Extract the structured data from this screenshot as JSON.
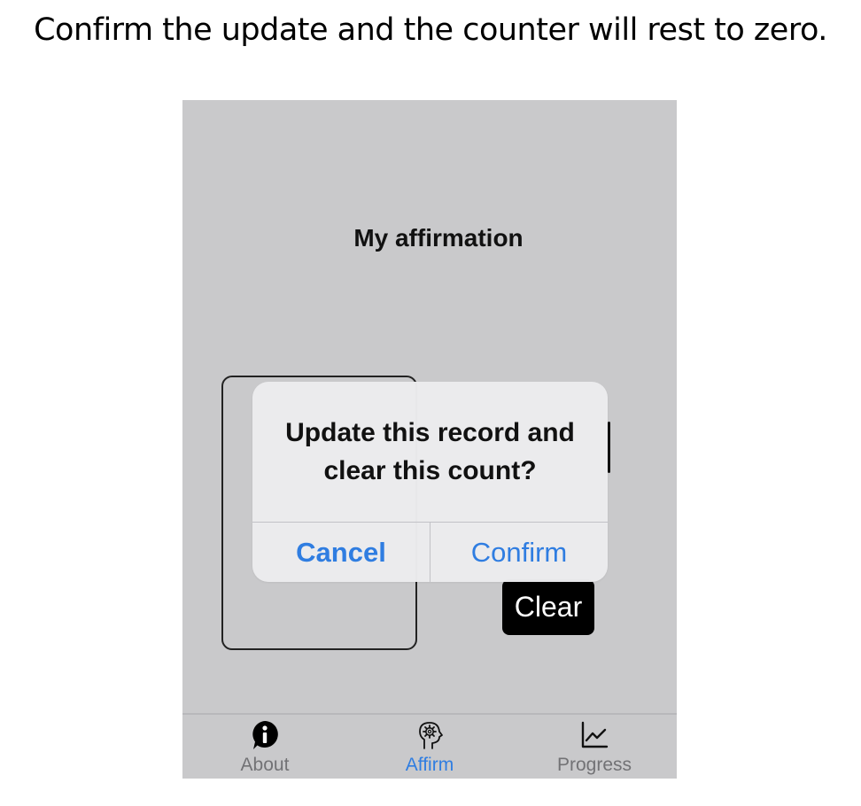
{
  "caption": "Confirm the update and the counter will rest to zero.",
  "screen": {
    "title": "My affirmation",
    "clear_label": "Clear"
  },
  "alert": {
    "message": "Update this record and clear this count?",
    "cancel_label": "Cancel",
    "confirm_label": "Confirm"
  },
  "tabbar": {
    "tabs": [
      {
        "label": "About",
        "icon": "info-bubble-icon",
        "active": false
      },
      {
        "label": "Affirm",
        "icon": "head-gear-icon",
        "active": true
      },
      {
        "label": "Progress",
        "icon": "line-chart-icon",
        "active": false
      }
    ]
  },
  "colors": {
    "screen_bg": "#c9c9cb",
    "accent": "#2f7de1",
    "inactive_tab": "#727275",
    "alert_bg": "#ececee"
  }
}
